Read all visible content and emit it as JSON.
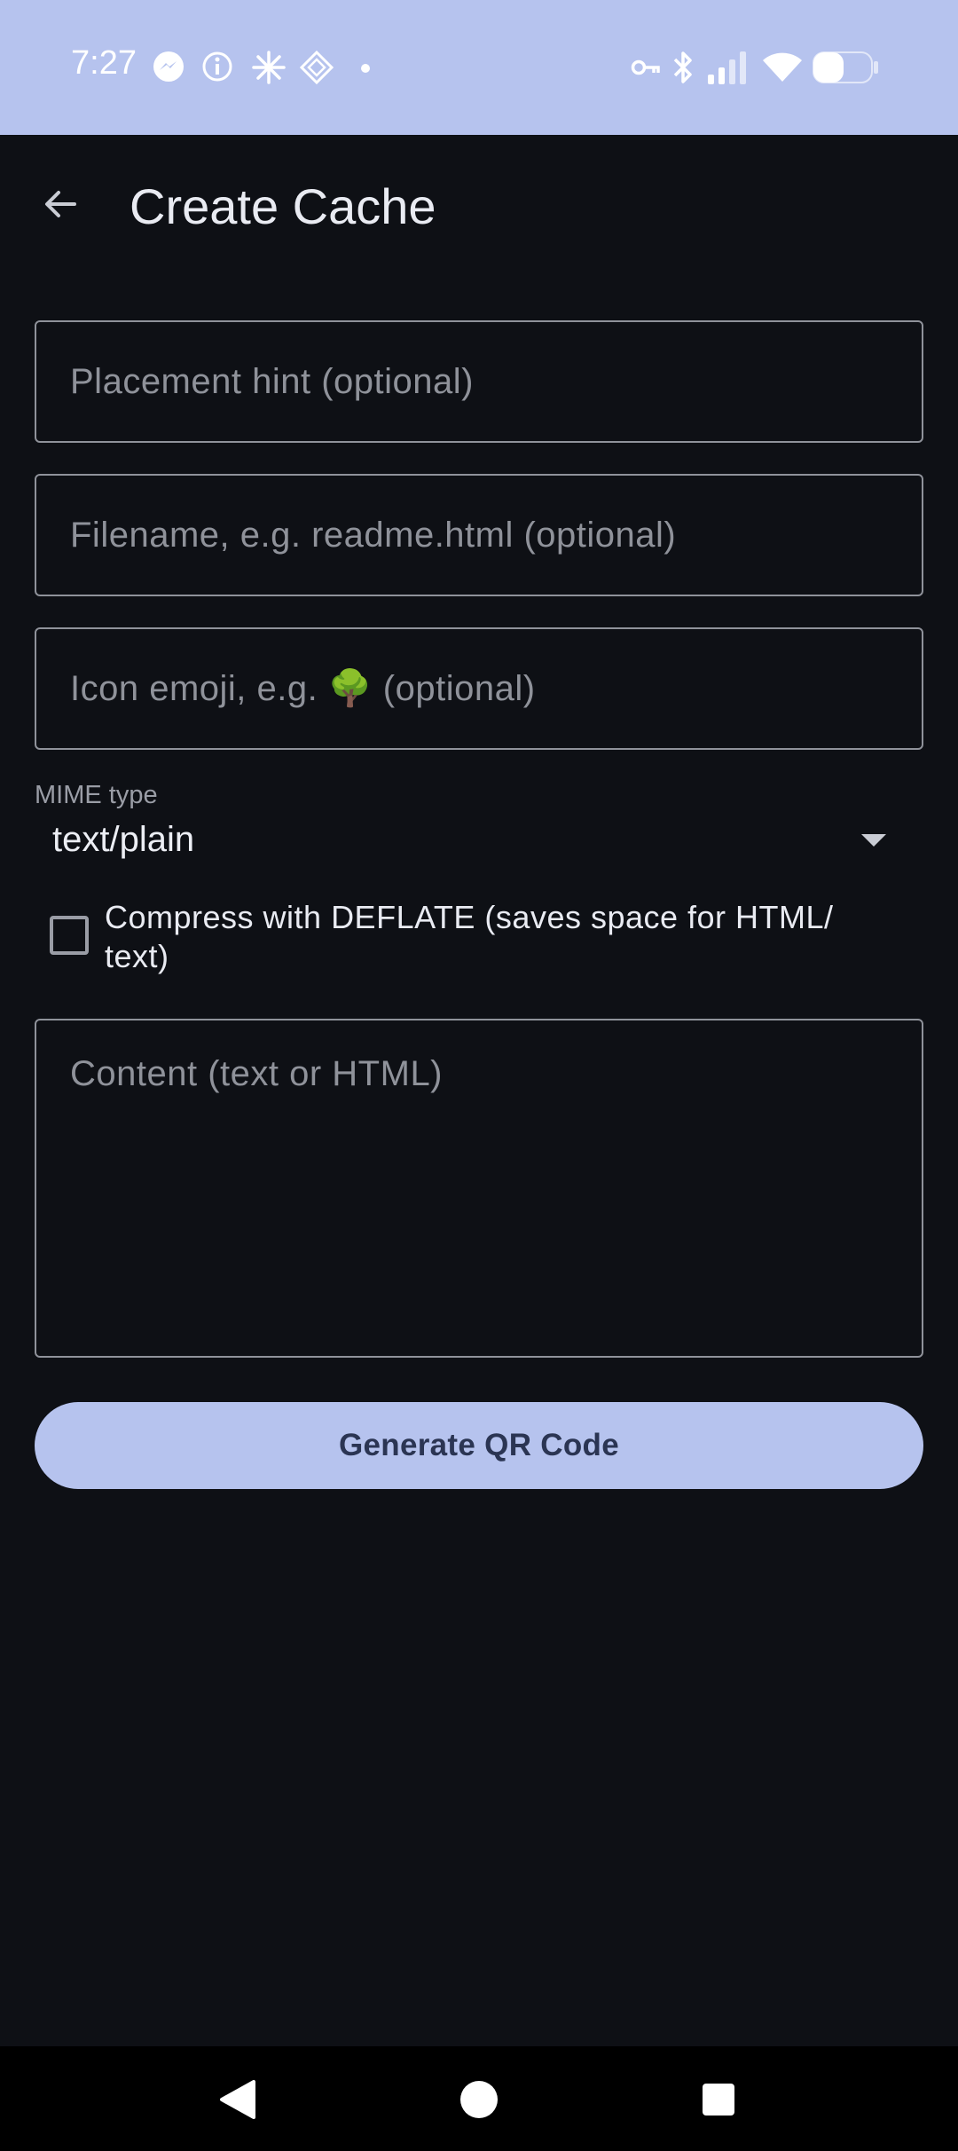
{
  "status_bar": {
    "time": "7:27",
    "left_icons": [
      "messenger-icon",
      "info-icon",
      "sparkle-icon",
      "diamond-grid-icon",
      "dot-icon"
    ],
    "right_icons": [
      "vpn-key-icon",
      "bluetooth-icon",
      "signal-icon",
      "wifi-icon",
      "battery-icon"
    ]
  },
  "app_bar": {
    "title": "Create Cache",
    "back_icon": "arrow-back-icon"
  },
  "form": {
    "placement_hint": {
      "value": "",
      "placeholder": "Placement hint (optional)"
    },
    "filename": {
      "value": "",
      "placeholder": "Filename, e.g. readme.html (optional)"
    },
    "icon_emoji": {
      "value": "",
      "placeholder": "Icon emoji, e.g. 🌳 (optional)"
    },
    "mime_type": {
      "label": "MIME type",
      "selected": "text/plain"
    },
    "compress": {
      "checked": false,
      "label": "Compress with DEFLATE (saves space for HTML/ text)"
    },
    "content": {
      "value": "",
      "placeholder": "Content (text or HTML)"
    },
    "submit_label": "Generate QR Code"
  },
  "nav_bar": {
    "buttons": [
      "back-triangle-icon",
      "home-circle-icon",
      "recents-square-icon"
    ]
  },
  "colors": {
    "accent": "#b6c3ee",
    "background": "#0e1015",
    "field_border": "#8f929a"
  }
}
